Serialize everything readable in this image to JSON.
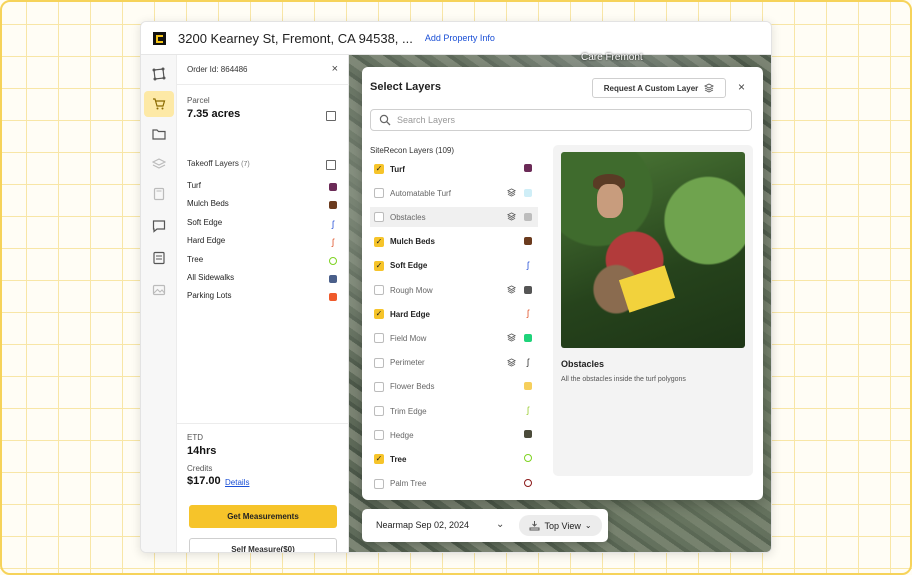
{
  "header": {
    "address": "3200 Kearney St, Fremont, CA 94538, ...",
    "property_link": "Add Property Info",
    "chevron": "‹"
  },
  "panel": {
    "order_id": "Order Id: 864486",
    "close": "×",
    "parcel_label": "Parcel",
    "parcel_value": "7.35 acres",
    "takeoff_label": "Takeoff Layers",
    "takeoff_count": "(7)",
    "layers": [
      {
        "label": "Turf",
        "color": "#6b2a57",
        "kind": "square"
      },
      {
        "label": "Mulch Beds",
        "color": "#6b3b1e",
        "kind": "square"
      },
      {
        "label": "Soft Edge",
        "color": "#2a54d8",
        "kind": "line"
      },
      {
        "label": "Hard Edge",
        "color": "#e0532a",
        "kind": "line"
      },
      {
        "label": "Tree",
        "color": "#7ed321",
        "kind": "circle"
      },
      {
        "label": "All Sidewalks",
        "color": "#4a5f8a",
        "kind": "square"
      },
      {
        "label": "Parking Lots",
        "color": "#ef5a2b",
        "kind": "square"
      }
    ],
    "etd_label": "ETD",
    "etd_value": "14hrs",
    "credits_label": "Credits",
    "credits_value": "$17.00",
    "details_link": "Details",
    "get_measurements": "Get Measurements",
    "self_measure": "Self Measure($0)"
  },
  "map": {
    "label": "Care Fremont"
  },
  "modal": {
    "title": "Select Layers",
    "request_button": "Request A Custom Layer",
    "close": "×",
    "search_placeholder": "Search Layers",
    "list_title": "SiteRecon Layers (109)",
    "items": [
      {
        "label": "Turf",
        "checked": true,
        "color": "#6b2a57",
        "kind": "square",
        "stack": false
      },
      {
        "label": "Automatable Turf",
        "checked": false,
        "color": "#cfeef7",
        "kind": "square",
        "stack": true
      },
      {
        "label": "Obstacles",
        "checked": false,
        "color": "#bdbdbd",
        "kind": "square",
        "stack": true
      },
      {
        "label": "Mulch Beds",
        "checked": true,
        "color": "#6b3b1e",
        "kind": "square",
        "stack": false
      },
      {
        "label": "Soft Edge",
        "checked": true,
        "color": "#2a54d8",
        "kind": "line",
        "stack": false
      },
      {
        "label": "Rough Mow",
        "checked": false,
        "color": "#555555",
        "kind": "square",
        "stack": true
      },
      {
        "label": "Hard Edge",
        "checked": true,
        "color": "#e0532a",
        "kind": "line",
        "stack": false
      },
      {
        "label": "Field Mow",
        "checked": false,
        "color": "#1fd37a",
        "kind": "square",
        "stack": true
      },
      {
        "label": "Perimeter",
        "checked": false,
        "color": "#333333",
        "kind": "line",
        "stack": true
      },
      {
        "label": "Flower Beds",
        "checked": false,
        "color": "#f6cf5c",
        "kind": "square",
        "stack": false
      },
      {
        "label": "Trim Edge",
        "checked": false,
        "color": "#9acd32",
        "kind": "line",
        "stack": false
      },
      {
        "label": "Hedge",
        "checked": false,
        "color": "#4b4b3a",
        "kind": "square",
        "stack": false
      },
      {
        "label": "Tree",
        "checked": true,
        "color": "#7ed321",
        "kind": "circle",
        "stack": false
      },
      {
        "label": "Palm Tree",
        "checked": false,
        "color": "#8b1a1a",
        "kind": "circle",
        "stack": false
      }
    ],
    "preview_title": "Obstacles",
    "preview_desc": "All the obstacles inside the turf polygons"
  },
  "datebar": {
    "date": "Nearmap Sep 02, 2024",
    "view": "Top View"
  }
}
